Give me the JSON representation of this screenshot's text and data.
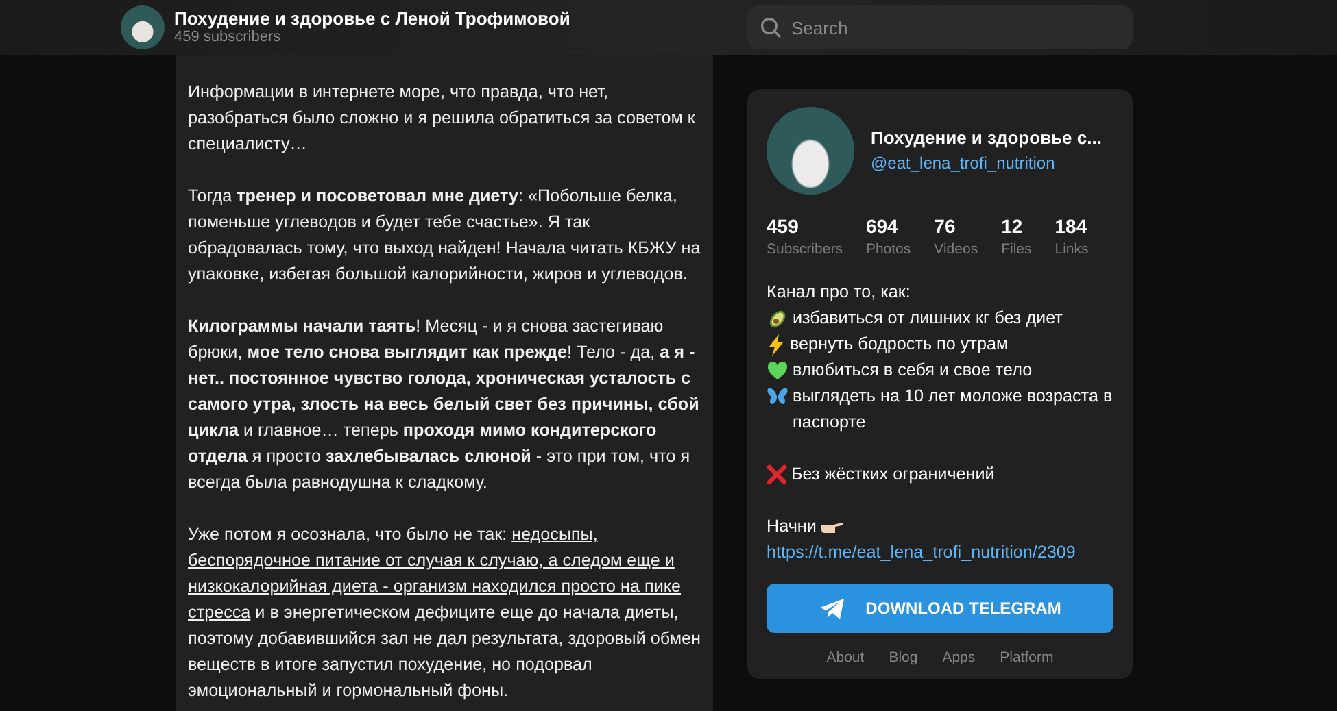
{
  "header": {
    "channel_title": "Похудение и здоровье с Леной Трофимовой",
    "subscribers": "459 subscribers",
    "search": {
      "placeholder": "Search"
    }
  },
  "post": {
    "paragraphs": [
      {
        "text": "Информации в интернете море, что правда, что нет, разобраться было сложно и я решила обратиться за советом к специалисту…"
      },
      {
        "text": "Тогда **тренер и посоветовал мне диету**: «Побольше белка, поменьше углеводов и будет тебе счастье». Я так обрадовалась тому, что выход найден! Начала читать КБЖУ на упаковке, избегая большой калорийности, жиров и углеводов."
      },
      {
        "text": "**Килограммы начали таять**! Месяц - и я снова застегиваю брюки, **мое тело снова выглядит как прежде**! Тело - да, **а я - нет.. постоянное чувство голода, хроническая усталость с самого утра, злость на весь белый свет без причины, сбой цикла** и главное… теперь **проходя мимо кондитерского отдела** я просто **захлебывалась слюной** - это при том, что я всегда была равнодушна к сладкому."
      },
      {
        "text": "Уже потом я осознала, что было не так: ",
        "underlined": "недосыпы, беспорядочное питание от случая к случаю, а следом еще и низкокалорийная диета - организм находился просто на пике стресса",
        "after": " и в энергетическом дефиците еще до начала диеты, поэтому добавившийся зал не дал результата, здоровый обмен веществ в итоге запустил похудение, но подорвал эмоциональный и гормональный фоны."
      }
    ]
  },
  "channel_card": {
    "title": "Похудение и здоровье с...",
    "handle": "@eat_lena_trofi_nutrition",
    "stats": [
      {
        "value": "459",
        "label": "Subscribers"
      },
      {
        "value": "694",
        "label": "Photos"
      },
      {
        "value": "76",
        "label": "Videos"
      },
      {
        "value": "12",
        "label": "Files"
      },
      {
        "value": "184",
        "label": "Links"
      }
    ],
    "description": [
      {
        "kind": "plain",
        "text": "Канал про то, как:"
      },
      {
        "kind": "avocado",
        "text": "избавиться от лишних кг без диет"
      },
      {
        "kind": "lightning",
        "text": "вернуть бодрость по утрам"
      },
      {
        "kind": "heart",
        "text": "влюбиться в себя и свое тело"
      },
      {
        "kind": "butterfly",
        "text": "выглядеть на 10 лет моложе возраста в паспорте"
      },
      {
        "kind": "blank"
      },
      {
        "kind": "cross",
        "text": "Без жёстких ограничений"
      },
      {
        "kind": "blank"
      },
      {
        "kind": "pointing",
        "text": "Начни"
      },
      {
        "kind": "link",
        "text": "https://t.me/eat_lena_trofi_nutrition/2309"
      }
    ],
    "button": "DOWNLOAD TELEGRAM",
    "footer_links": [
      "About",
      "Blog",
      "Apps",
      "Platform"
    ]
  }
}
